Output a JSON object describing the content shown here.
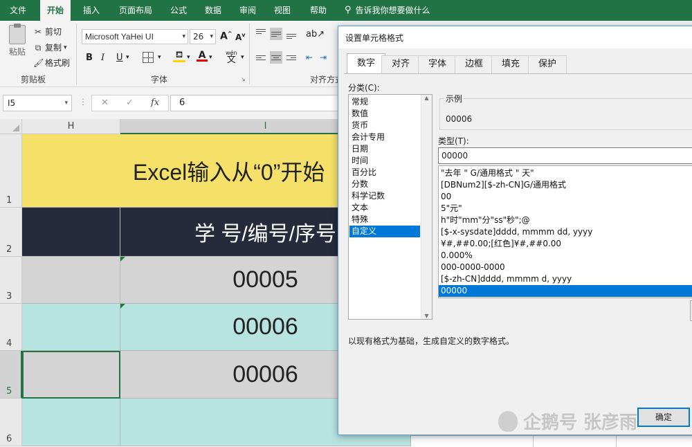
{
  "ribbon_tabs": [
    "文件",
    "开始",
    "插入",
    "页面布局",
    "公式",
    "数据",
    "审阅",
    "视图",
    "帮助"
  ],
  "active_tab": "开始",
  "tell_me": "告诉我你想要做什么",
  "clipboard": {
    "paste": "粘贴",
    "cut": "剪切",
    "copy": "复制",
    "painter": "格式刷",
    "label": "剪贴板"
  },
  "font": {
    "name": "Microsoft YaHei UI",
    "size": "26",
    "label": "字体",
    "bold": "B",
    "italic": "I",
    "underline": "U",
    "grow": "A",
    "shrink": "A",
    "phonetic": "wén"
  },
  "alignment": {
    "label": "对齐方式"
  },
  "formula_bar": {
    "name_box": "I5",
    "cancel": "✕",
    "enter": "✓",
    "fx": "fx",
    "value": "6"
  },
  "columns": [
    "H",
    "I"
  ],
  "rows": [
    "1",
    "2",
    "3",
    "4",
    "5",
    "6"
  ],
  "cells": {
    "title": "Excel输入从“0”开始",
    "header": "学 号/编号/序号",
    "r3": "00005",
    "r4": "00006",
    "r5": "00006"
  },
  "colors": {
    "excel_green": "#217346",
    "title_bg": "#f5e06a",
    "header_bg": "#262a3a",
    "row_gray": "#d4d4d4",
    "row_teal": "#b7e4e1",
    "selection": "#0078d7"
  },
  "dialog": {
    "title": "设置单元格格式",
    "close": "✕",
    "tabs": [
      "数字",
      "对齐",
      "字体",
      "边框",
      "填充",
      "保护"
    ],
    "active_tab": "数字",
    "category_label": "分类(C):",
    "categories": [
      "常规",
      "数值",
      "货币",
      "会计专用",
      "日期",
      "时间",
      "百分比",
      "分数",
      "科学记数",
      "文本",
      "特殊",
      "自定义"
    ],
    "selected_category": "自定义",
    "sample_label": "示例",
    "sample_value": "00006",
    "type_label": "类型(T):",
    "type_value": "00000",
    "formats": [
      "\"去年 \" G/通用格式 \" 天\"",
      "[DBNum2][$-zh-CN]G/通用格式",
      "00",
      "5\"元\"",
      "h\"时\"mm\"分\"ss\"秒\";@",
      "[$-x-sysdate]dddd, mmmm dd, yyyy",
      "¥#,##0.00;[红色]¥#,##0.00",
      "0.000%",
      "000-0000-0000",
      "[$-zh-CN]dddd, mmmm d, yyyy",
      "00000"
    ],
    "selected_format": "00000",
    "description": "以现有格式为基础，生成自定义的数字格式。",
    "ok": "确定"
  },
  "watermark": "企鹅号 张彦雨"
}
